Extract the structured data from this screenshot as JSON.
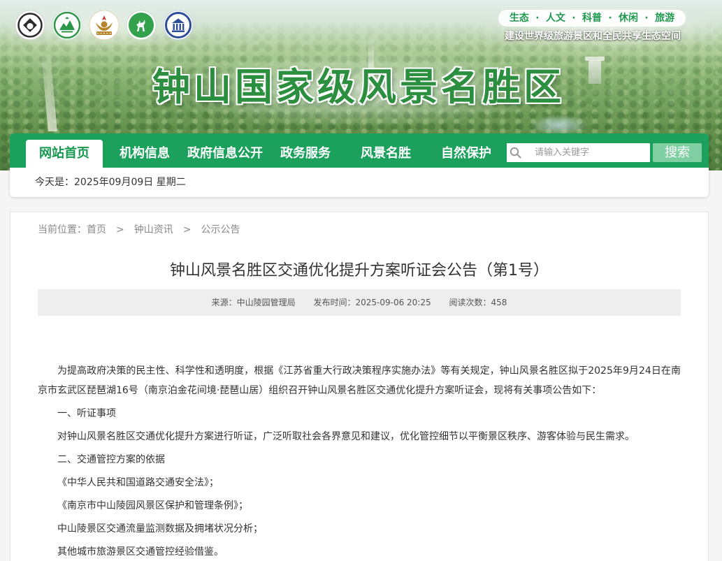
{
  "header": {
    "logos": [
      "heritage-emblem-icon",
      "green-mountain-emblem-icon",
      "gold-aaaaa-emblem-icon",
      "green-deer-emblem-icon",
      "blue-building-emblem-icon"
    ],
    "tagline": "生态 · 人文 · 科普 · 休闲 · 旅游",
    "slogan": "建设世界级旅游景区和全民共享生态空间",
    "site_title": "钟山国家级风景名胜区"
  },
  "nav": {
    "items": [
      {
        "label": "网站首页",
        "active": true
      },
      {
        "label": "机构信息",
        "active": false
      },
      {
        "label": "政府信息公开",
        "active": false
      },
      {
        "label": "政务服务",
        "active": false
      },
      {
        "label": "风景名胜",
        "active": false
      },
      {
        "label": "自然保护",
        "active": false
      }
    ],
    "search": {
      "icon": "search-icon",
      "placeholder": "请输入关键字",
      "value": "",
      "button_label": "搜索"
    }
  },
  "date_bar": {
    "text": "今天是：2025年09月09日 星期二"
  },
  "breadcrumb": {
    "prefix": "当前位置：",
    "items": [
      "首页",
      "钟山资讯",
      "公示公告"
    ],
    "separator": ">"
  },
  "article": {
    "title": "钟山风景名胜区交通优化提升方案听证会公告（第1号）",
    "meta": {
      "source": "来源：中山陵园管理局",
      "published": "发布时间：2025-09-06 20:25",
      "views": "阅读次数：458"
    },
    "paragraphs": [
      "为提高政府决策的民主性、科学性和透明度，根据《江苏省重大行政决策程序实施办法》等有关规定，钟山风景名胜区拟于2025年9月24日在南京市玄武区琵琶湖16号（南京泊金花间境·琵琶山居）组织召开钟山风景名胜区交通优化提升方案听证会，现将有关事项公告如下：",
      "一、听证事项",
      "对钟山风景名胜区交通优化提升方案进行听证，广泛听取社会各界意见和建议，优化管控细节以平衡景区秩序、游客体验与民生需求。",
      "二、交通管控方案的依据",
      "《中华人民共和国道路交通安全法》；",
      "《南京市中山陵园风景区保护和管理条例》；",
      "中山陵景区交通流量监测数据及拥堵状况分析；",
      "其他城市旅游景区交通管控经验借鉴。"
    ]
  },
  "colors": {
    "nav_green": "#1ba15c",
    "active_tab_text": "#16994f",
    "search_button": "#7fcfa2",
    "tagline_text": "#1f9a4f",
    "site_title_green": "#2c8f3f",
    "meta_background": "#eeeeee",
    "body_text": "#333333",
    "breadcrumb_text": "#888888"
  }
}
